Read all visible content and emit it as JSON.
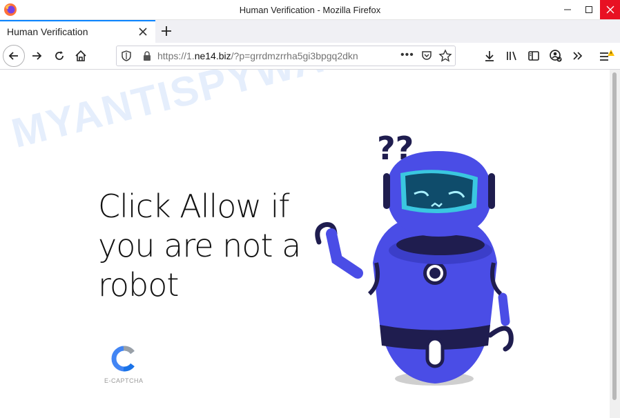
{
  "window": {
    "title": "Human Verification - Mozilla Firefox"
  },
  "tab": {
    "label": "Human Verification"
  },
  "urlbar": {
    "host_prefix": "https://1.",
    "host": "ne14.biz",
    "path": "/?p=grrdmzrrha5gi3bpgq2dkn"
  },
  "page": {
    "headline": "Click Allow if you are not a robot",
    "captcha_label": "E-CAPTCHA",
    "watermark": "MYANTISPYWARE.COM",
    "robot_question": "??"
  },
  "colors": {
    "robot_body": "#4a4de6",
    "robot_dark": "#1f1d4f",
    "visor": "#3ac7e0",
    "accent_tab": "#0a84ff"
  },
  "icons": [
    "firefox-logo",
    "minimize-icon",
    "maximize-icon",
    "close-icon",
    "tab-close-icon",
    "new-tab-icon",
    "back-icon",
    "forward-icon",
    "reload-icon",
    "home-icon",
    "shield-icon",
    "lock-icon",
    "page-actions-icon",
    "pocket-icon",
    "bookmark-star-icon",
    "download-icon",
    "library-icon",
    "sidebar-icon",
    "account-icon",
    "overflow-icon",
    "menu-icon"
  ]
}
